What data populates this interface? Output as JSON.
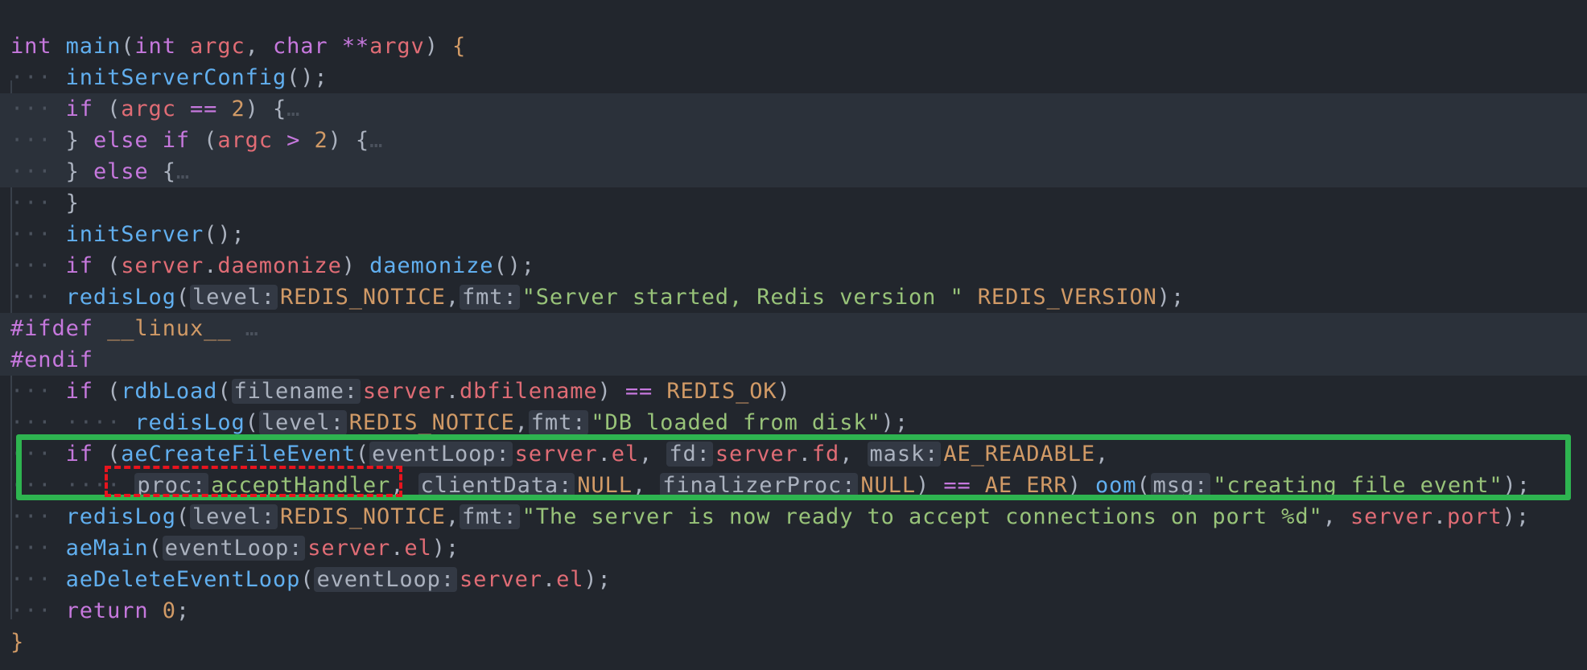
{
  "editor": {
    "colors": {
      "background": "#22262d",
      "folded_region_background": "#2b313a",
      "inlay_hint_background": "#333944",
      "keyword": "#c678dd",
      "function": "#61afef",
      "variable": "#e06c75",
      "constant": "#d19a66",
      "string": "#98c379",
      "plain": "#abb2bf",
      "indent_dots": "#4b525d",
      "highlight_box": "#2eb450",
      "dashed_box": "#e8141e"
    },
    "fold_marker": "…",
    "annotations": {
      "green_box": "highlighted aeCreateFileEvent call",
      "red_dashed_box": "proc: acceptHandler argument"
    },
    "lines": [
      {
        "folded_bg": false,
        "tokens": [
          [
            "kw",
            "int"
          ],
          [
            "p",
            " "
          ],
          [
            "fn",
            "main"
          ],
          [
            "p",
            "("
          ],
          [
            "kw",
            "int"
          ],
          [
            "p",
            " "
          ],
          [
            "var",
            "argc"
          ],
          [
            "p",
            ", "
          ],
          [
            "kw",
            "char"
          ],
          [
            "p",
            " "
          ],
          [
            "kw",
            "**"
          ],
          [
            "var",
            "argv"
          ],
          [
            "p",
            ") "
          ],
          [
            "cst",
            "{"
          ]
        ]
      },
      {
        "folded_bg": false,
        "tokens": [
          [
            "dots",
            "···"
          ],
          [
            "p",
            " "
          ],
          [
            "fn",
            "initServerConfig"
          ],
          [
            "p",
            "();"
          ]
        ]
      },
      {
        "folded_bg": true,
        "tokens": [
          [
            "dots",
            "···"
          ],
          [
            "p",
            " "
          ],
          [
            "kw",
            "if"
          ],
          [
            "p",
            " ("
          ],
          [
            "var",
            "argc"
          ],
          [
            "p",
            " "
          ],
          [
            "kw",
            "=="
          ],
          [
            "p",
            " "
          ],
          [
            "cst",
            "2"
          ],
          [
            "p",
            ") {"
          ],
          [
            "dots",
            "…"
          ]
        ]
      },
      {
        "folded_bg": true,
        "tokens": [
          [
            "dots",
            "···"
          ],
          [
            "p",
            " } "
          ],
          [
            "kw",
            "else"
          ],
          [
            "p",
            " "
          ],
          [
            "kw",
            "if"
          ],
          [
            "p",
            " ("
          ],
          [
            "var",
            "argc"
          ],
          [
            "p",
            " "
          ],
          [
            "kw",
            ">"
          ],
          [
            "p",
            " "
          ],
          [
            "cst",
            "2"
          ],
          [
            "p",
            ") {"
          ],
          [
            "dots",
            "…"
          ]
        ]
      },
      {
        "folded_bg": true,
        "tokens": [
          [
            "dots",
            "···"
          ],
          [
            "p",
            " } "
          ],
          [
            "kw",
            "else"
          ],
          [
            "p",
            " {"
          ],
          [
            "dots",
            "…"
          ]
        ]
      },
      {
        "folded_bg": false,
        "tokens": [
          [
            "dots",
            "···"
          ],
          [
            "p",
            " }"
          ]
        ]
      },
      {
        "folded_bg": false,
        "tokens": [
          [
            "dots",
            "···"
          ],
          [
            "p",
            " "
          ],
          [
            "fn",
            "initServer"
          ],
          [
            "p",
            "();"
          ]
        ]
      },
      {
        "folded_bg": false,
        "tokens": [
          [
            "dots",
            "···"
          ],
          [
            "p",
            " "
          ],
          [
            "kw",
            "if"
          ],
          [
            "p",
            " ("
          ],
          [
            "var",
            "server"
          ],
          [
            "p",
            "."
          ],
          [
            "var",
            "daemonize"
          ],
          [
            "p",
            ") "
          ],
          [
            "fn",
            "daemonize"
          ],
          [
            "p",
            "();"
          ]
        ]
      },
      {
        "folded_bg": false,
        "tokens": [
          [
            "dots",
            "···"
          ],
          [
            "p",
            " "
          ],
          [
            "fn",
            "redisLog"
          ],
          [
            "p",
            "("
          ],
          [
            "hint",
            "level:"
          ],
          [
            "cst",
            "REDIS_NOTICE"
          ],
          [
            "p",
            ","
          ],
          [
            "hint",
            "fmt:"
          ],
          [
            "str",
            "\"Server started, Redis version \""
          ],
          [
            "p",
            " "
          ],
          [
            "cst",
            "REDIS_VERSION"
          ],
          [
            "p",
            ");"
          ]
        ]
      },
      {
        "folded_bg": true,
        "tokens": [
          [
            "kw",
            "#ifdef"
          ],
          [
            "p",
            " "
          ],
          [
            "cst",
            "__linux__"
          ],
          [
            "p",
            " "
          ],
          [
            "dots",
            "…"
          ]
        ]
      },
      {
        "folded_bg": true,
        "tokens": [
          [
            "kw",
            "#endif"
          ]
        ]
      },
      {
        "folded_bg": false,
        "tokens": [
          [
            "dots",
            "···"
          ],
          [
            "p",
            " "
          ],
          [
            "kw",
            "if"
          ],
          [
            "p",
            " ("
          ],
          [
            "fn",
            "rdbLoad"
          ],
          [
            "p",
            "("
          ],
          [
            "hint",
            "filename:"
          ],
          [
            "var",
            "server"
          ],
          [
            "p",
            "."
          ],
          [
            "var",
            "dbfilename"
          ],
          [
            "p",
            ") "
          ],
          [
            "kw",
            "=="
          ],
          [
            "p",
            " "
          ],
          [
            "cst",
            "REDIS_OK"
          ],
          [
            "p",
            ")"
          ]
        ]
      },
      {
        "folded_bg": false,
        "tokens": [
          [
            "dots",
            "···"
          ],
          [
            "p",
            " "
          ],
          [
            "dots",
            "····"
          ],
          [
            "p",
            " "
          ],
          [
            "fn",
            "redisLog"
          ],
          [
            "p",
            "("
          ],
          [
            "hint",
            "level:"
          ],
          [
            "cst",
            "REDIS_NOTICE"
          ],
          [
            "p",
            ","
          ],
          [
            "hint",
            "fmt:"
          ],
          [
            "str",
            "\"DB loaded from disk\""
          ],
          [
            "p",
            ");"
          ]
        ]
      },
      {
        "folded_bg": false,
        "tokens": [
          [
            "dots",
            "···"
          ],
          [
            "p",
            " "
          ],
          [
            "kw",
            "if"
          ],
          [
            "p",
            " ("
          ],
          [
            "fn",
            "aeCreateFileEvent"
          ],
          [
            "p",
            "("
          ],
          [
            "hint",
            "eventLoop:"
          ],
          [
            "var",
            "server"
          ],
          [
            "p",
            "."
          ],
          [
            "var",
            "el"
          ],
          [
            "p",
            ", "
          ],
          [
            "hint",
            "fd:"
          ],
          [
            "var",
            "server"
          ],
          [
            "p",
            "."
          ],
          [
            "var",
            "fd"
          ],
          [
            "p",
            ", "
          ],
          [
            "hint",
            "mask:"
          ],
          [
            "cst",
            "AE_READABLE"
          ],
          [
            "p",
            ","
          ]
        ]
      },
      {
        "folded_bg": false,
        "tokens": [
          [
            "dots",
            "···"
          ],
          [
            "p",
            " "
          ],
          [
            "dots",
            "····"
          ],
          [
            "p",
            " "
          ],
          [
            "hint",
            "proc:"
          ],
          [
            "str",
            "acceptHandler"
          ],
          [
            "p",
            ", "
          ],
          [
            "hint",
            "clientData:"
          ],
          [
            "cst",
            "NULL"
          ],
          [
            "p",
            ", "
          ],
          [
            "hint",
            "finalizerProc:"
          ],
          [
            "cst",
            "NULL"
          ],
          [
            "p",
            ") "
          ],
          [
            "kw",
            "=="
          ],
          [
            "p",
            " "
          ],
          [
            "cst",
            "AE_ERR"
          ],
          [
            "p",
            ") "
          ],
          [
            "fn",
            "oom"
          ],
          [
            "p",
            "("
          ],
          [
            "hint",
            "msg:"
          ],
          [
            "str",
            "\"creating file event\""
          ],
          [
            "p",
            ");"
          ]
        ]
      },
      {
        "folded_bg": false,
        "tokens": [
          [
            "dots",
            "···"
          ],
          [
            "p",
            " "
          ],
          [
            "fn",
            "redisLog"
          ],
          [
            "p",
            "("
          ],
          [
            "hint",
            "level:"
          ],
          [
            "cst",
            "REDIS_NOTICE"
          ],
          [
            "p",
            ","
          ],
          [
            "hint",
            "fmt:"
          ],
          [
            "str",
            "\"The server is now ready to accept connections on port %d\""
          ],
          [
            "p",
            ", "
          ],
          [
            "var",
            "server"
          ],
          [
            "p",
            "."
          ],
          [
            "var",
            "port"
          ],
          [
            "p",
            ");"
          ]
        ]
      },
      {
        "folded_bg": false,
        "tokens": [
          [
            "dots",
            "···"
          ],
          [
            "p",
            " "
          ],
          [
            "fn",
            "aeMain"
          ],
          [
            "p",
            "("
          ],
          [
            "hint",
            "eventLoop:"
          ],
          [
            "var",
            "server"
          ],
          [
            "p",
            "."
          ],
          [
            "var",
            "el"
          ],
          [
            "p",
            ");"
          ]
        ]
      },
      {
        "folded_bg": false,
        "tokens": [
          [
            "dots",
            "···"
          ],
          [
            "p",
            " "
          ],
          [
            "fn",
            "aeDeleteEventLoop"
          ],
          [
            "p",
            "("
          ],
          [
            "hint",
            "eventLoop:"
          ],
          [
            "var",
            "server"
          ],
          [
            "p",
            "."
          ],
          [
            "var",
            "el"
          ],
          [
            "p",
            ");"
          ]
        ]
      },
      {
        "folded_bg": false,
        "tokens": [
          [
            "dots",
            "···"
          ],
          [
            "p",
            " "
          ],
          [
            "kw",
            "return"
          ],
          [
            "p",
            " "
          ],
          [
            "cst",
            "0"
          ],
          [
            "p",
            ";"
          ]
        ]
      },
      {
        "folded_bg": false,
        "tokens": [
          [
            "cst",
            "}"
          ]
        ]
      }
    ]
  }
}
